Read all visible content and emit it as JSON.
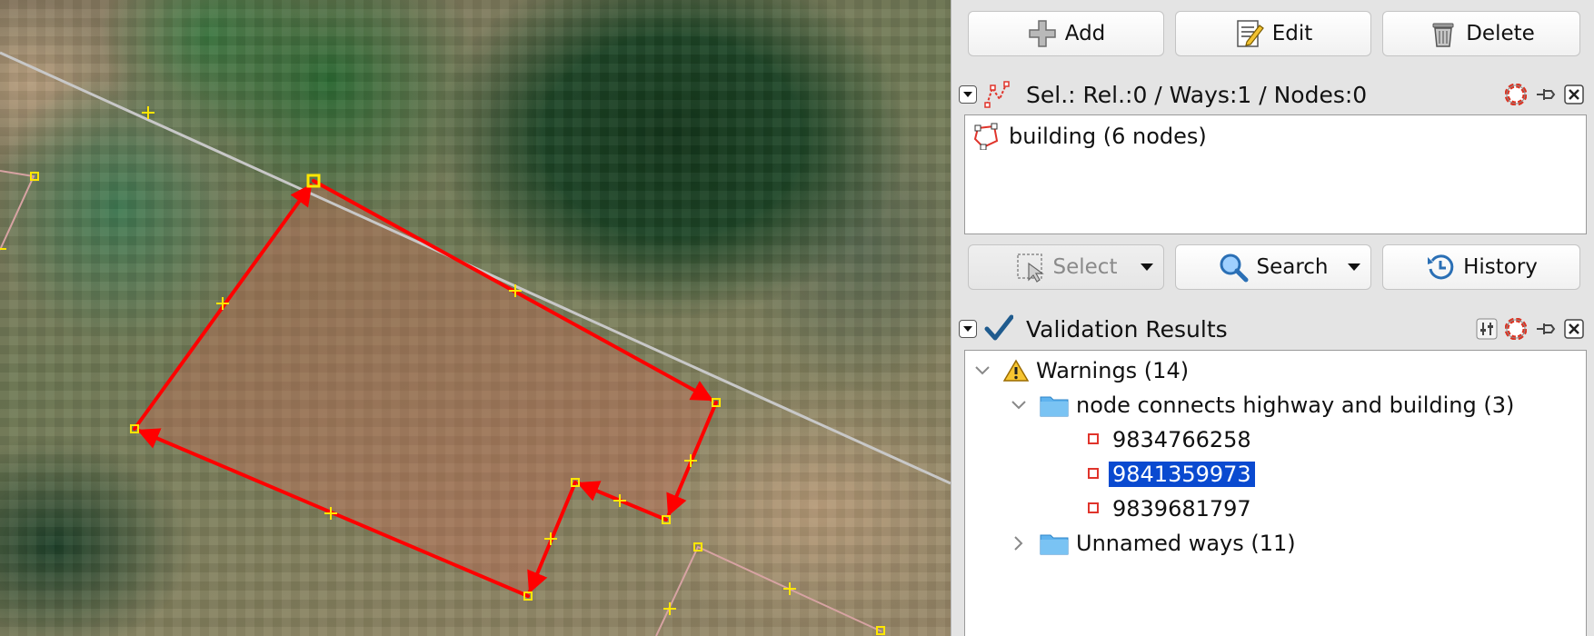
{
  "toolbar": {
    "add_label": "Add",
    "edit_label": "Edit",
    "delete_label": "Delete"
  },
  "selection_dialog": {
    "title": "Sel.: Rel.:0 / Ways:1 / Nodes:0",
    "items": [
      {
        "label": "building (6 nodes)",
        "icon": "way-polygon-icon"
      }
    ],
    "buttons": {
      "select_label": "Select",
      "search_label": "Search",
      "history_label": "History"
    }
  },
  "validation_dialog": {
    "title": "Validation Results",
    "warnings_label": "Warnings (14)",
    "groups": [
      {
        "label": "node connects highway and building (3)",
        "expanded": true,
        "nodes": [
          "9834766258",
          "9841359973",
          "9839681797"
        ],
        "selected_node": "9841359973"
      },
      {
        "label": "Unnamed ways (11)",
        "expanded": false
      }
    ]
  },
  "colors": {
    "selected_way": "#ff0000",
    "node_marker": "#ffe600",
    "road": "#c8c8c8",
    "building_outline": "#d7a3a3",
    "selection_highlight": "#0a4ad0"
  }
}
